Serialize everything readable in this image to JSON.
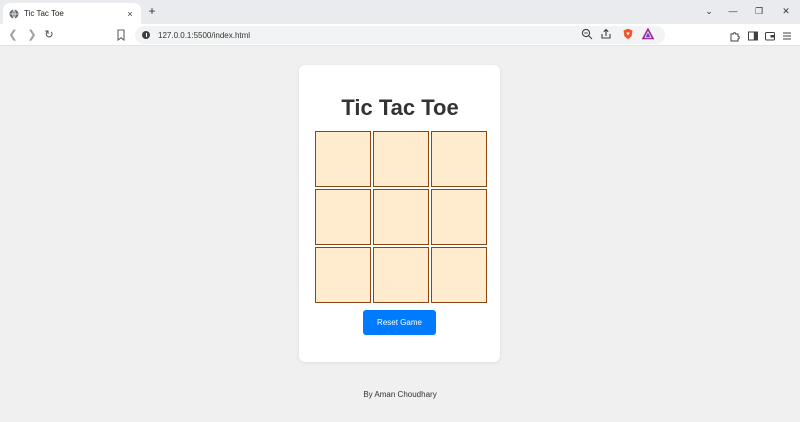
{
  "browser": {
    "tab_title": "Tic Tac Toe",
    "tab_close": "×",
    "new_tab": "+",
    "url": "127.0.0.1:5500/index.html",
    "window_controls": [
      "⌄",
      "—",
      "❐",
      "✕"
    ]
  },
  "game": {
    "title": "Tic Tac Toe",
    "cells": [
      "",
      "",
      "",
      "",
      "",
      "",
      "",
      "",
      ""
    ],
    "reset_label": "Reset Game"
  },
  "footer": {
    "credit": "By Aman Choudhary"
  },
  "colors": {
    "page_bg": "#f0f0f0",
    "cell_bg": "#ffebcd",
    "cell_border": "#8b4513",
    "button": "#007bff"
  }
}
